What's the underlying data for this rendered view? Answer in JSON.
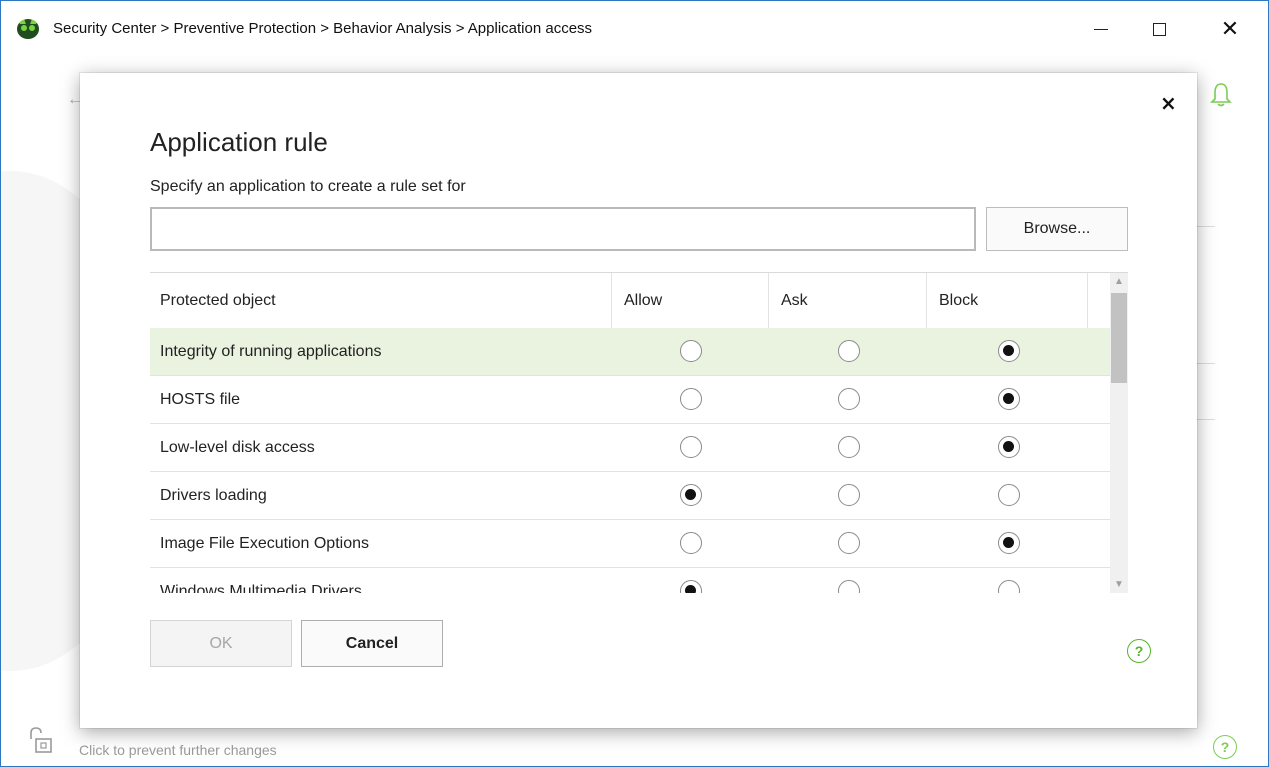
{
  "window": {
    "breadcrumb": "Security Center > Preventive Protection > Behavior Analysis > Application access",
    "footer_text": "Click to prevent further changes",
    "help_label": "?"
  },
  "dialog": {
    "title": "Application rule",
    "field_label": "Specify an application to create a rule set for",
    "path_value": "",
    "browse_label": "Browse...",
    "ok_label": "OK",
    "cancel_label": "Cancel",
    "help_label": "?",
    "close_label": "×"
  },
  "table": {
    "columns": [
      "Protected object",
      "Allow",
      "Ask",
      "Block"
    ],
    "rows": [
      {
        "name": "Integrity of running applications",
        "selected_option": "Block",
        "highlighted": true
      },
      {
        "name": "HOSTS file",
        "selected_option": "Block",
        "highlighted": false
      },
      {
        "name": "Low-level disk access",
        "selected_option": "Block",
        "highlighted": false
      },
      {
        "name": "Drivers loading",
        "selected_option": "Allow",
        "highlighted": false
      },
      {
        "name": "Image File Execution Options",
        "selected_option": "Block",
        "highlighted": false
      },
      {
        "name": "Windows Multimedia Drivers",
        "selected_option": "Allow",
        "highlighted": false
      }
    ]
  },
  "colors": {
    "accent_green": "#55b52b",
    "selected_row": "#e9f3df",
    "window_border": "#2b78c5"
  },
  "icons": [
    "app-logo-icon",
    "minimize-icon",
    "maximize-icon",
    "close-icon",
    "back-arrow-icon",
    "bell-icon",
    "lock-icon",
    "help-icon",
    "scroll-up-icon",
    "scroll-down-icon"
  ]
}
